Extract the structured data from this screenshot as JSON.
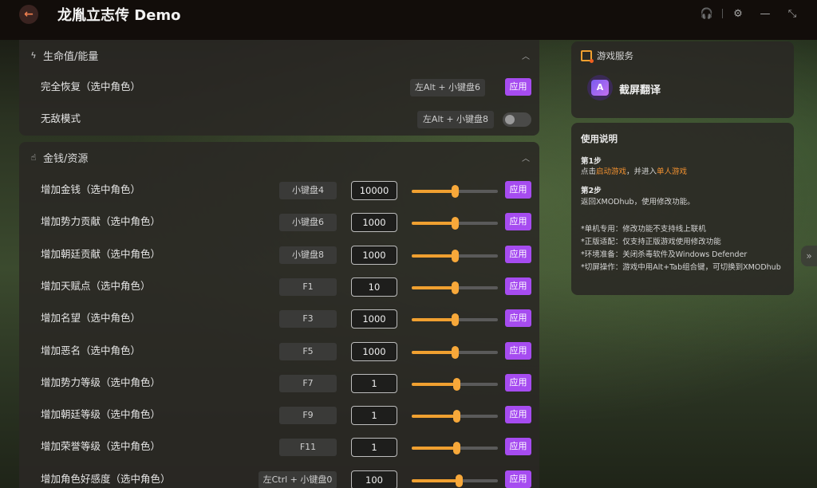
{
  "app": {
    "title": "龙胤立志传 Demo"
  },
  "window_controls": [
    {
      "name": "headset-icon",
      "glyph": "🎧"
    },
    {
      "name": "settings-icon",
      "glyph": "⚙"
    },
    {
      "name": "minimize-icon",
      "glyph": "—"
    },
    {
      "name": "collapse-icon",
      "glyph": "⤡"
    }
  ],
  "sections": {
    "health": {
      "title": "生命值/能量",
      "rows": [
        {
          "label": "完全恢复（选中角色）",
          "hotkey": "左Alt + 小键盘6",
          "action": "应用"
        },
        {
          "label": "无敌模式",
          "hotkey": "左Alt + 小键盘8",
          "toggle_on": false
        }
      ]
    },
    "money": {
      "title": "金钱/资源",
      "rows": [
        {
          "label": "增加金钱（选中角色）",
          "hotkey": "小键盘4",
          "value": "10000",
          "level": 0.5,
          "action": "应用"
        },
        {
          "label": "增加势力贡献（选中角色）",
          "hotkey": "小键盘6",
          "value": "1000",
          "level": 0.5,
          "action": "应用"
        },
        {
          "label": "增加朝廷贡献（选中角色）",
          "hotkey": "小键盘8",
          "value": "1000",
          "level": 0.5,
          "action": "应用"
        },
        {
          "label": "增加天赋点（选中角色）",
          "hotkey": "F1",
          "value": "10",
          "level": 0.5,
          "action": "应用"
        },
        {
          "label": "增加名望（选中角色）",
          "hotkey": "F3",
          "value": "1000",
          "level": 0.5,
          "action": "应用"
        },
        {
          "label": "增加恶名（选中角色）",
          "hotkey": "F5",
          "value": "1000",
          "level": 0.5,
          "action": "应用"
        },
        {
          "label": "增加势力等级（选中角色）",
          "hotkey": "F7",
          "value": "1",
          "level": 0.52,
          "action": "应用"
        },
        {
          "label": "增加朝廷等级（选中角色）",
          "hotkey": "F9",
          "value": "1",
          "level": 0.52,
          "action": "应用"
        },
        {
          "label": "增加荣誉等级（选中角色）",
          "hotkey": "F11",
          "value": "1",
          "level": 0.52,
          "action": "应用"
        },
        {
          "label": "增加角色好感度（选中角色）",
          "hotkey": "左Ctrl + 小键盘0",
          "value": "100",
          "level": 0.55,
          "action": "应用"
        }
      ]
    }
  },
  "services": {
    "title": "游戏服务",
    "item": {
      "label": "截屏翻译",
      "glyph": "A"
    }
  },
  "usage": {
    "title": "使用说明",
    "step1_title": "第1步",
    "step1_pre": "点击",
    "step1_link1": "启动游戏",
    "step1_mid": "，并进入",
    "step1_link2": "单人游戏",
    "step2_title": "第2步",
    "step2_text": "返回XMODhub，使用修改功能。",
    "notes": [
      "*单机专用：修改功能不支持线上联机",
      "*正版适配：仅支持正版游戏使用修改功能",
      "*环境准备：关闭杀毒软件及Windows Defender",
      "*切屏操作：游戏中用Alt+Tab组合键，可切换到XMODhub"
    ]
  },
  "colors": {
    "accent": "#a64cf0",
    "slider": "#f0a030",
    "link": "#f09030"
  }
}
